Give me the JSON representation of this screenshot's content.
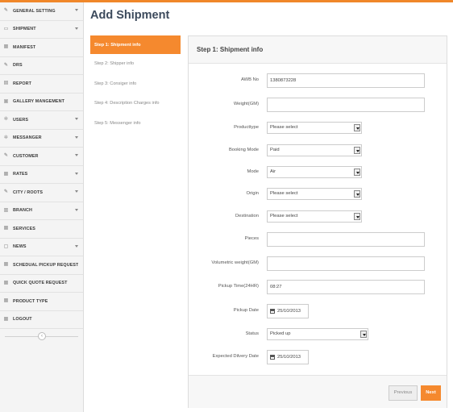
{
  "header": {
    "title": "Add Shipment"
  },
  "sidebar": {
    "items": [
      {
        "label": "GENERAL SETTING",
        "icon": "pencil-icon",
        "has_arrow": true
      },
      {
        "label": "SHIPMENT",
        "icon": "shipment-icon",
        "has_arrow": true
      },
      {
        "label": "MANIFEST",
        "icon": "grid-icon",
        "has_arrow": false
      },
      {
        "label": "DRS",
        "icon": "pencil-icon",
        "has_arrow": false
      },
      {
        "label": "REPORT",
        "icon": "document-icon",
        "has_arrow": false
      },
      {
        "label": "GALLERY MANGEMENT",
        "icon": "gallery-icon",
        "has_arrow": false
      },
      {
        "label": "USERS",
        "icon": "gear-icon",
        "has_arrow": true
      },
      {
        "label": "MESSANGER",
        "icon": "gear-icon",
        "has_arrow": true
      },
      {
        "label": "CUSTOMER",
        "icon": "pencil-icon",
        "has_arrow": true
      },
      {
        "label": "RATES",
        "icon": "grid-icon",
        "has_arrow": true
      },
      {
        "label": "CITY / ROOTS",
        "icon": "pencil-icon",
        "has_arrow": true
      },
      {
        "label": "BRANCH",
        "icon": "branch-icon",
        "has_arrow": true
      },
      {
        "label": "SERVICES",
        "icon": "grid-icon",
        "has_arrow": false
      },
      {
        "label": "NEWS",
        "icon": "news-icon",
        "has_arrow": true
      },
      {
        "label": "SCHEDUAL PICKUP REQUEST",
        "icon": "grid-icon",
        "has_arrow": false
      },
      {
        "label": "QUICK QUOTE REQUEST",
        "icon": "grid-icon",
        "has_arrow": false
      },
      {
        "label": "PRODUCT TYPE",
        "icon": "grid-icon",
        "has_arrow": false
      },
      {
        "label": "LOGOUT",
        "icon": "grid-icon",
        "has_arrow": false
      }
    ],
    "collapse_glyph": "‹"
  },
  "steps": [
    {
      "label": "Step 1: Shipment info",
      "active": true
    },
    {
      "label": "Step 2: Shipper info",
      "active": false
    },
    {
      "label": "Step 3: Consiger info",
      "active": false
    },
    {
      "label": "Step 4: Description Charges info",
      "active": false
    },
    {
      "label": "Step 5: Messenger info",
      "active": false
    }
  ],
  "panel": {
    "title": "Step 1: Shipment info",
    "fields": {
      "awb": {
        "label": "AWB No",
        "value": "1380873228"
      },
      "weight": {
        "label": "Weight(GM)",
        "value": ""
      },
      "producttype": {
        "label": "Producttype",
        "value": "Please select"
      },
      "booking_mode": {
        "label": "Booking Mode",
        "value": "Paid"
      },
      "mode": {
        "label": "Mode",
        "value": "Air"
      },
      "origin": {
        "label": "Origin",
        "value": "Please select"
      },
      "destination": {
        "label": "Destination",
        "value": "Please select"
      },
      "pieces": {
        "label": "Pieces",
        "value": ""
      },
      "volumetric": {
        "label": "Volumetric weight(GM)",
        "value": ""
      },
      "pickup_time": {
        "label": "Pickup Time(24HR)",
        "value": "08:27"
      },
      "pickup_date": {
        "label": "Pickup Date",
        "value": "25/10/2013"
      },
      "status": {
        "label": "Status",
        "value": "Picked up"
      },
      "expected_date": {
        "label": "Expected Dilvery Date",
        "value": "25/10/2013"
      }
    },
    "buttons": {
      "previous": "Previous",
      "next": "Next"
    }
  },
  "colors": {
    "accent": "#f5892e",
    "title": "#3c4a5c"
  }
}
